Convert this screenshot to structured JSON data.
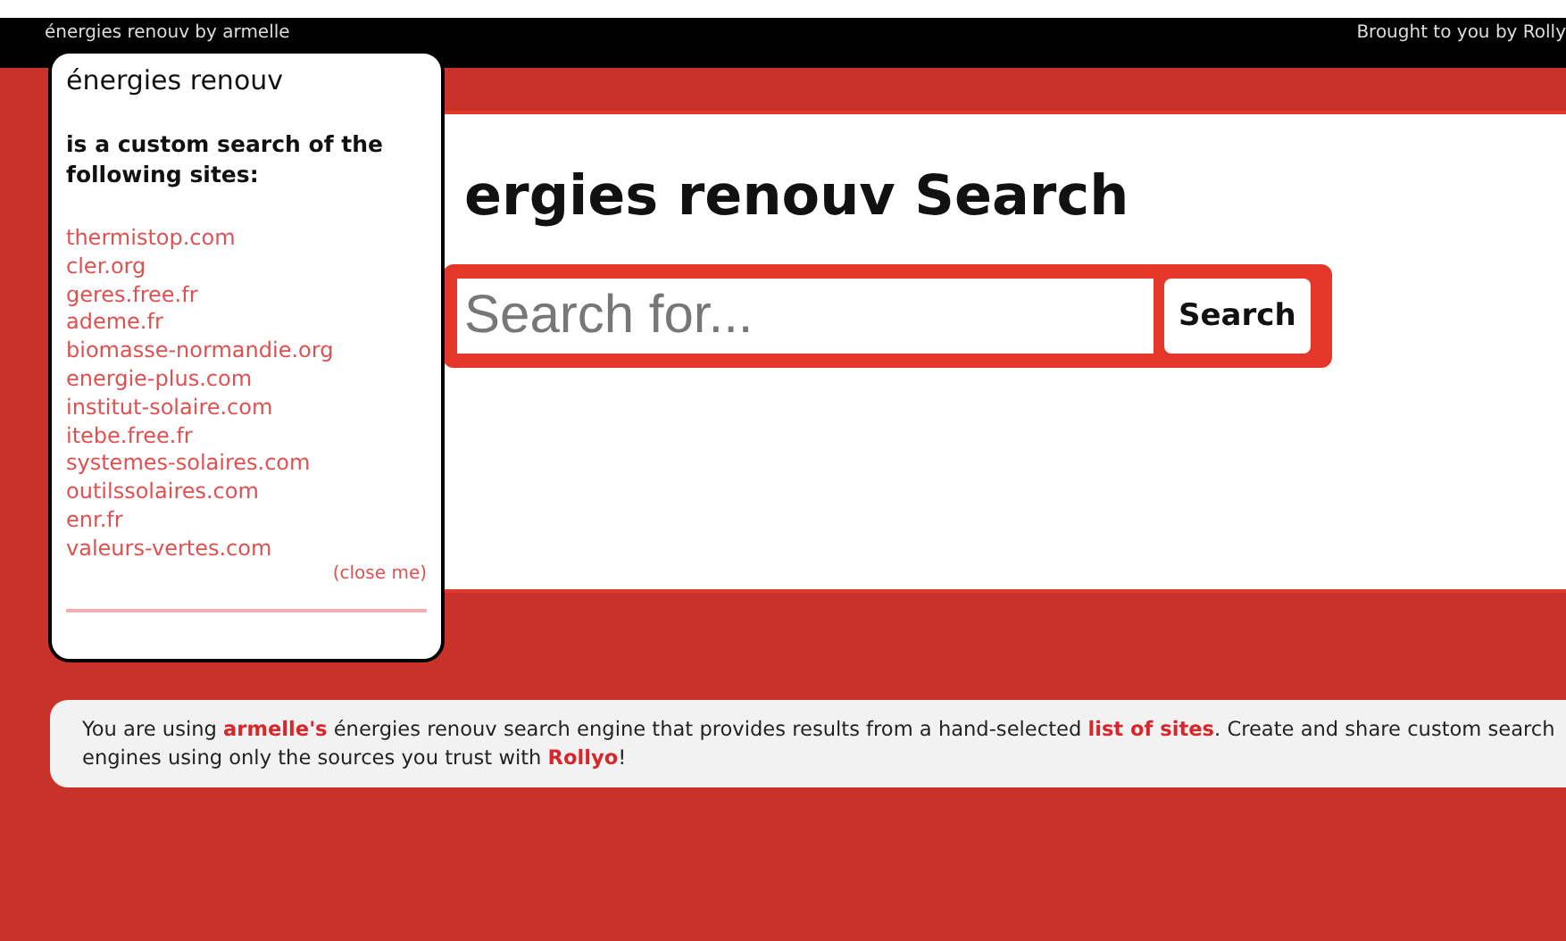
{
  "top_bar": {
    "title": "énergies renouv by armelle",
    "credit": "Brought to you by Rolly"
  },
  "search": {
    "heading": "ergies renouv Search",
    "placeholder": "Search for...",
    "button": "Search"
  },
  "popup": {
    "title": "énergies renouv",
    "subtitle": "is a custom search of the following sites:",
    "sites": [
      "thermistop.com",
      "cler.org",
      "geres.free.fr",
      "ademe.fr",
      "biomasse-normandie.org",
      "energie-plus.com",
      "institut-solaire.com",
      "itebe.free.fr",
      "systemes-solaires.com",
      "outilssolaires.com",
      "enr.fr",
      "valeurs-vertes.com"
    ],
    "close": "(close me)"
  },
  "info": {
    "parts": [
      {
        "kind": "text",
        "text": "You are using "
      },
      {
        "kind": "link",
        "text": "armelle's"
      },
      {
        "kind": "text",
        "text": " énergies renouv search engine that provides results from a hand-selected "
      },
      {
        "kind": "link",
        "text": "list of sites"
      },
      {
        "kind": "text",
        "text": ". Create and share custom search engines using only the sources you trust with "
      },
      {
        "kind": "link",
        "text": "Rollyo"
      },
      {
        "kind": "text",
        "text": "!"
      }
    ]
  }
}
